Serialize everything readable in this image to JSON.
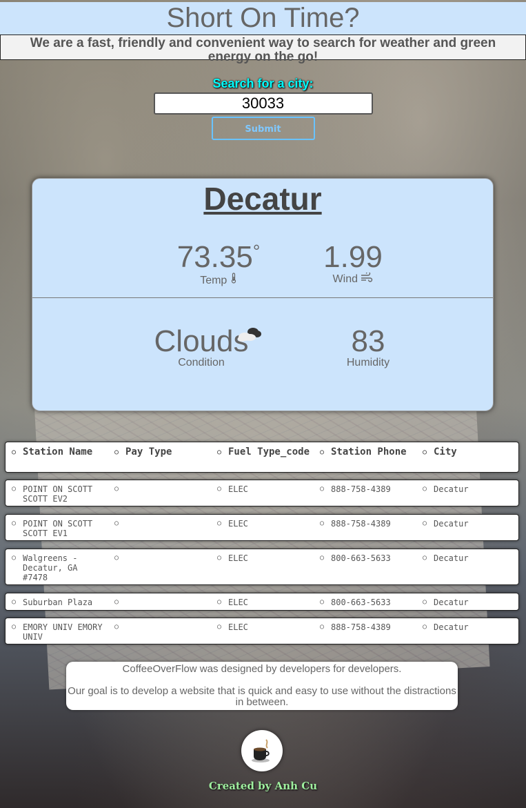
{
  "header": {
    "title": "Short On Time?",
    "tagline": "We are a fast, friendly and convenient way to search for weather and green energy on the go!"
  },
  "search": {
    "label": "Search for a city:",
    "value": "30033",
    "submit_label": "Submit"
  },
  "weather": {
    "city": "Decatur",
    "temp_value": "73.35",
    "temp_unit": "°",
    "temp_label": "Temp",
    "wind_value": "1.99",
    "wind_label": "Wind",
    "condition_value": "Clouds",
    "condition_label": "Condition",
    "humidity_value": "83",
    "humidity_label": "Humidity"
  },
  "stations": {
    "headers": [
      "Station Name",
      "Pay Type",
      "Fuel Type_code",
      "Station Phone",
      "City"
    ],
    "rows": [
      {
        "name": "POINT ON SCOTT SCOTT EV2",
        "pay": "",
        "fuel": "ELEC",
        "phone": "888-758-4389",
        "city": "Decatur"
      },
      {
        "name": "POINT ON SCOTT SCOTT EV1",
        "pay": "",
        "fuel": "ELEC",
        "phone": "888-758-4389",
        "city": "Decatur"
      },
      {
        "name": "Walgreens - Decatur, GA #7478",
        "pay": "",
        "fuel": "ELEC",
        "phone": "800-663-5633",
        "city": "Decatur"
      },
      {
        "name": "Suburban Plaza",
        "pay": "",
        "fuel": "ELEC",
        "phone": "800-663-5633",
        "city": "Decatur"
      },
      {
        "name": "EMORY UNIV EMORY UNIV",
        "pay": "",
        "fuel": "ELEC",
        "phone": "888-758-4389",
        "city": "Decatur"
      }
    ]
  },
  "about": {
    "line1": "CoffeeOverFlow was designed by developers for developers.",
    "line2": "Our goal is to develop a website that is quick and easy to use without the distractions in between."
  },
  "footer": {
    "credit": "Created by Anh Cu",
    "logo_icon": "coffee-cup-icon"
  },
  "colors": {
    "header_bg": "#cce4fc",
    "card_bg": "#cce4fc",
    "label_cyan": "#00ffff",
    "submit_border": "#69c3ff",
    "credit_green": "#9ff09f"
  }
}
